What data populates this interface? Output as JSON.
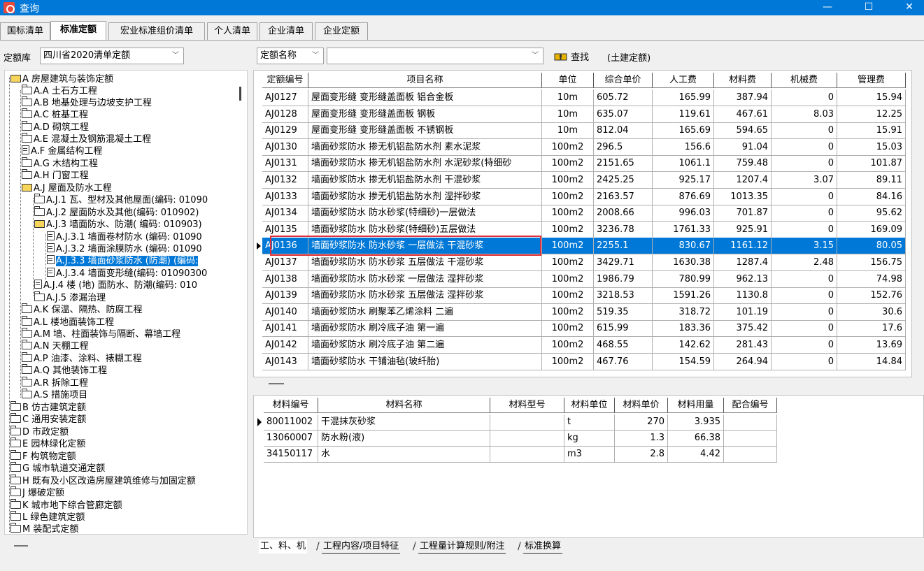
{
  "window": {
    "title": "查询",
    "minimize": "—",
    "maximize": "☐",
    "close": "✕"
  },
  "tabs": [
    "国标清单",
    "标准定额",
    "宏业标准组价清单",
    "个人清单",
    "企业清单",
    "企业定额"
  ],
  "toolbar": {
    "lib_label": "定额库",
    "lib_value": "四川省2020清单定额",
    "field_value": "定额名称",
    "search_value": "",
    "find_label": "查找",
    "scope_label": "(土建定额)"
  },
  "tree": [
    "A 房屋建筑与装饰定额",
    "A.A 土石方工程",
    "A.B 地基处理与边坡支护工程",
    "A.C 桩基工程",
    "A.D 砌筑工程",
    "A.E 混凝土及钢筋混凝土工程",
    "A.F 金属结构工程",
    "A.G 木结构工程",
    "A.H 门窗工程",
    "A.J 屋面及防水工程",
    "A.J.1 瓦、型材及其他屋面(编码: 01090",
    "A.J.2 屋面防水及其他(编码: 010902)",
    "A.J.3 墙面防水、防潮( 编码: 010903)",
    "A.J.3.1 墙面卷材防水 (编码: 01090",
    "A.J.3.2 墙面涂膜防水 (编码: 01090",
    "A.J.3.3 墙面砂浆防水 (防潮) (编码:",
    "A.J.3.4 墙面变形缝(编码: 01090300",
    "A.J.4 楼 (地) 面防水、防潮(编码: 010",
    "A.J.5 渗漏治理",
    "A.K 保温、隔热、防腐工程",
    "A.L 楼地面装饰工程",
    "A.M 墙、柱面装饰与隔断、幕墙工程",
    "A.N 天棚工程",
    "A.P 油漆、涂料、裱糊工程",
    "A.Q 其他装饰工程",
    "A.R 拆除工程",
    "A.S 措施项目",
    "B 仿古建筑定额",
    "C 通用安装定额",
    "D 市政定额",
    "E 园林绿化定额",
    "F 构筑物定额",
    "G 城市轨道交通定额",
    "H 既有及小区改造房屋建筑维修与加固定额",
    "J 爆破定额",
    "K 城市地下综合管廊定额",
    "L 绿色建筑定额",
    "M 装配式定额"
  ],
  "grid": {
    "headers": [
      "定额编号",
      "项目名称",
      "单位",
      "综合单价",
      "人工费",
      "材料费",
      "机械费",
      "管理费"
    ],
    "rows": [
      [
        "AJ0127",
        "屋面变形缝 变形缝盖面板 铝合金板",
        "10m",
        "605.72",
        "165.99",
        "387.94",
        "0",
        "15.94"
      ],
      [
        "AJ0128",
        "屋面变形缝 变形缝盖面板 钢板",
        "10m",
        "635.07",
        "119.61",
        "467.61",
        "8.03",
        "12.25"
      ],
      [
        "AJ0129",
        "屋面变形缝 变形缝盖面板 不锈钢板",
        "10m",
        "812.04",
        "165.69",
        "594.65",
        "0",
        "15.91"
      ],
      [
        "AJ0130",
        "墙面砂浆防水 掺无机铝盐防水剂 素水泥浆",
        "100m2",
        "296.5",
        "156.6",
        "91.04",
        "0",
        "15.03"
      ],
      [
        "AJ0131",
        "墙面砂浆防水 掺无机铝盐防水剂 水泥砂浆(特细砂",
        "100m2",
        "2151.65",
        "1061.1",
        "759.48",
        "0",
        "101.87"
      ],
      [
        "AJ0132",
        "墙面砂浆防水 掺无机铝盐防水剂 干混砂浆",
        "100m2",
        "2425.25",
        "925.17",
        "1207.4",
        "3.07",
        "89.11"
      ],
      [
        "AJ0133",
        "墙面砂浆防水 掺无机铝盐防水剂 湿拌砂浆",
        "100m2",
        "2163.57",
        "876.69",
        "1013.35",
        "0",
        "84.16"
      ],
      [
        "AJ0134",
        "墙面砂浆防水 防水砂浆(特细砂)一层做法",
        "100m2",
        "2008.66",
        "996.03",
        "701.87",
        "0",
        "95.62"
      ],
      [
        "AJ0135",
        "墙面砂浆防水 防水砂浆(特细砂)五层做法",
        "100m2",
        "3236.78",
        "1761.33",
        "925.91",
        "0",
        "169.09"
      ],
      [
        "AJ0136",
        "墙面砂浆防水 防水砂浆 一层做法 干混砂浆",
        "100m2",
        "2255.1",
        "830.67",
        "1161.12",
        "3.15",
        "80.05"
      ],
      [
        "AJ0137",
        "墙面砂浆防水 防水砂浆 五层做法 干混砂浆",
        "100m2",
        "3429.71",
        "1630.38",
        "1287.4",
        "2.48",
        "156.75"
      ],
      [
        "AJ0138",
        "墙面砂浆防水 防水砂浆 一层做法 湿拌砂浆",
        "100m2",
        "1986.79",
        "780.99",
        "962.13",
        "0",
        "74.98"
      ],
      [
        "AJ0139",
        "墙面砂浆防水 防水砂浆 五层做法 湿拌砂浆",
        "100m2",
        "3218.53",
        "1591.26",
        "1130.8",
        "0",
        "152.76"
      ],
      [
        "AJ0140",
        "墙面砂浆防水 刷聚苯乙烯涂料 二遍",
        "100m2",
        "519.35",
        "318.72",
        "101.19",
        "0",
        "30.6"
      ],
      [
        "AJ0141",
        "墙面砂浆防水 刷冷底子油 第一遍",
        "100m2",
        "615.99",
        "183.36",
        "375.42",
        "0",
        "17.6"
      ],
      [
        "AJ0142",
        "墙面砂浆防水 刷冷底子油 第二遍",
        "100m2",
        "468.55",
        "142.62",
        "281.43",
        "0",
        "13.69"
      ],
      [
        "AJ0143",
        "墙面砂浆防水 干铺油毡(玻纤胎)",
        "100m2",
        "467.76",
        "154.59",
        "264.94",
        "0",
        "14.84"
      ]
    ]
  },
  "materials": {
    "headers": [
      "材料编号",
      "材料名称",
      "材料型号",
      "材料单位",
      "材料单价",
      "材料用量",
      "配合编号"
    ],
    "rows": [
      [
        "80011002",
        "干混抹灰砂浆",
        "",
        "t",
        "270",
        "3.935",
        ""
      ],
      [
        "13060007",
        "防水粉(液)",
        "",
        "kg",
        "1.3",
        "66.38",
        ""
      ],
      [
        "34150117",
        "水",
        "",
        "m3",
        "2.8",
        "4.42",
        ""
      ]
    ]
  },
  "bottom_tabs": [
    "工、料、机",
    "工程内容/项目特征",
    "工程量计算规则/附注",
    "标准换算"
  ]
}
